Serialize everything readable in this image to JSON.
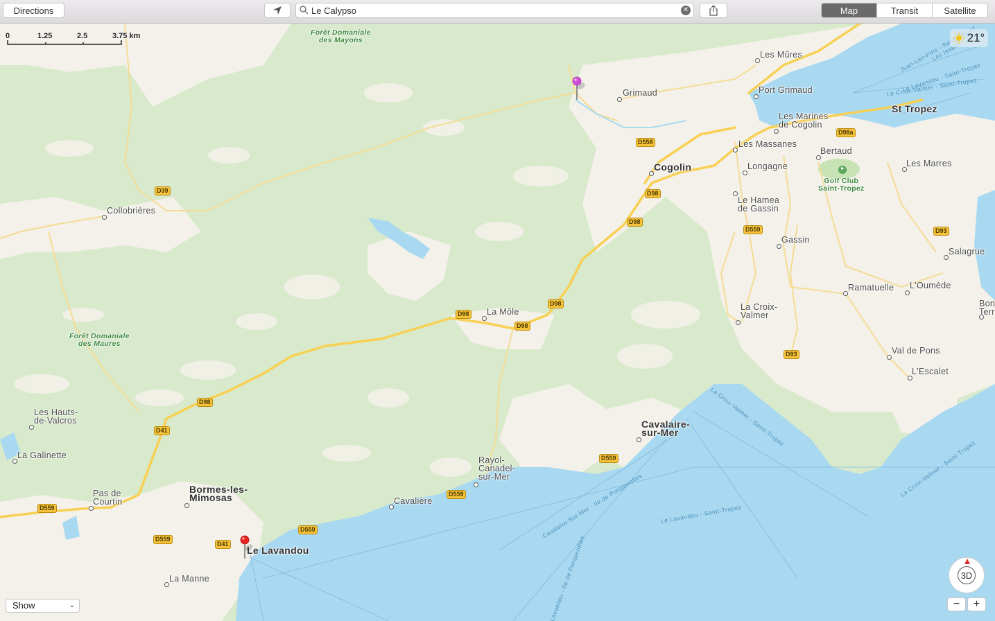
{
  "toolbar": {
    "directions_label": "Directions",
    "search_value": "Le Calypso",
    "view_modes": [
      "Map",
      "Transit",
      "Satellite"
    ],
    "active_mode": "Map"
  },
  "scale": {
    "labels": [
      "0",
      "1.25",
      "2.5",
      "3.75 km"
    ]
  },
  "weather": {
    "temperature": "21°",
    "icon": "sun-icon"
  },
  "controls": {
    "three_d_label": "3D",
    "zoom_out": "−",
    "zoom_in": "+",
    "show_label": "Show"
  },
  "pins": [
    {
      "name": "selected-place-pin",
      "color": "#d24bd9"
    },
    {
      "name": "le-lavandou-pin",
      "color": "#e8241e"
    }
  ],
  "places": [
    {
      "name": "Grimaud",
      "size": "normal"
    },
    {
      "name": "Port Grimaud",
      "size": "normal"
    },
    {
      "name": "Les Mûres",
      "size": "normal"
    },
    {
      "name": "Les Marines\nde Cogolin",
      "size": "normal"
    },
    {
      "name": "St Tropez",
      "size": "big"
    },
    {
      "name": "Les Massanes",
      "size": "normal"
    },
    {
      "name": "Bertaud",
      "size": "normal"
    },
    {
      "name": "Cogolin",
      "size": "big"
    },
    {
      "name": "Longagne",
      "size": "normal"
    },
    {
      "name": "Les Marres",
      "size": "normal"
    },
    {
      "name": "Le Hamea\nde Gassin",
      "size": "normal"
    },
    {
      "name": "Gassin",
      "size": "normal"
    },
    {
      "name": "Salagrue",
      "size": "normal"
    },
    {
      "name": "Ramatuelle",
      "size": "normal"
    },
    {
      "name": "L'Oumède",
      "size": "normal"
    },
    {
      "name": "Bon\nTerr",
      "size": "normal"
    },
    {
      "name": "La Croix-\nValmer",
      "size": "normal"
    },
    {
      "name": "Val de Pons",
      "size": "normal"
    },
    {
      "name": "L'Escalet",
      "size": "normal"
    },
    {
      "name": "Collobrières",
      "size": "normal"
    },
    {
      "name": "La Môle",
      "size": "normal"
    },
    {
      "name": "Les Hauts-\nde-Valcros",
      "size": "normal"
    },
    {
      "name": "La Galinette",
      "size": "normal"
    },
    {
      "name": "Pas de\nCourtin",
      "size": "normal"
    },
    {
      "name": "Bormes-les-\nMimosas",
      "size": "big"
    },
    {
      "name": "Cavalaire-\nsur-Mer",
      "size": "big"
    },
    {
      "name": "Rayol-\nCanadel-\nsur-Mer",
      "size": "normal"
    },
    {
      "name": "Cavalière",
      "size": "normal"
    },
    {
      "name": "Le Lavandou",
      "size": "big"
    },
    {
      "name": "La Manne",
      "size": "normal"
    }
  ],
  "forests": [
    "Forêt Domaniale\ndes Mayons",
    "Forêt Domaniale\ndes Maures"
  ],
  "golf": "Golf Club\nSaint-Tropez",
  "roads": [
    "D558",
    "D98a",
    "D39",
    "D98",
    "D98",
    "D559",
    "D93",
    "D98",
    "D98",
    "D98",
    "D93",
    "D98",
    "D41",
    "D559",
    "D559",
    "D559",
    "D559",
    "D41",
    "D559"
  ],
  "ferries": [
    "Juan-Les-Pins - Saint-Tropez",
    "Le Lavandou - Saint-Tropez",
    "Le Croix-Valmer - Saint-Tropez",
    "Les Issam...",
    "La Croix-Valmer - Saint-Tropez",
    "Cavalaire-Sur-Mer - Ile de Porquerolles",
    "Le Lavandou - Saint-Tropez",
    "La Croix-Valmer - Saint-Tropez",
    "Lavandou - Ile de Porquerolles"
  ],
  "colors": {
    "water": "#a9d9f1",
    "forest": "#d6e9c9",
    "urban": "#f4f2ea",
    "road_major": "#f8d053",
    "road_minor": "#f6e0a0"
  }
}
